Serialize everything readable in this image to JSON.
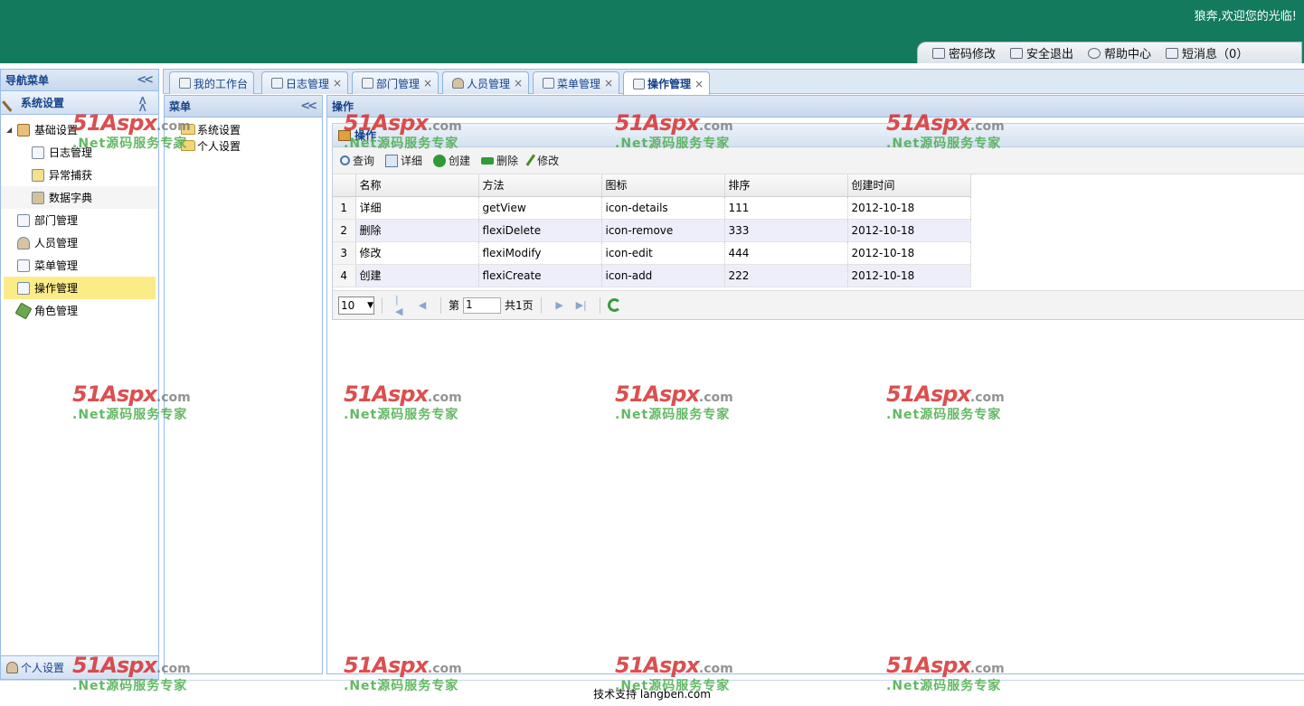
{
  "header": {
    "welcome": "狼奔,欢迎您的光临!",
    "links": [
      "密码修改",
      "安全退出",
      "帮助中心",
      "短消息（0）"
    ]
  },
  "nav": {
    "title": "导航菜单",
    "section": "系统设置",
    "tree": {
      "root": "基础设置",
      "children": [
        "日志管理",
        "异常捕获",
        "数据字典"
      ],
      "items": [
        "部门管理",
        "人员管理",
        "菜单管理",
        "操作管理",
        "角色管理"
      ],
      "selected": "操作管理"
    },
    "footer": "个人设置"
  },
  "tabs": [
    {
      "label": "我的工作台",
      "closable": false
    },
    {
      "label": "日志管理",
      "closable": true
    },
    {
      "label": "部门管理",
      "closable": true
    },
    {
      "label": "人员管理",
      "closable": true
    },
    {
      "label": "菜单管理",
      "closable": true
    },
    {
      "label": "操作管理",
      "closable": true,
      "active": true
    }
  ],
  "menu_panel": {
    "title": "菜单",
    "folders": [
      "系统设置",
      "个人设置"
    ]
  },
  "content": {
    "title": "操作",
    "grid_title": "操作",
    "toolbar": [
      "查询",
      "详细",
      "创建",
      "删除",
      "修改"
    ],
    "columns": [
      "名称",
      "方法",
      "图标",
      "排序",
      "创建时间"
    ],
    "rows": [
      {
        "n": "1",
        "name": "详细",
        "method": "getView",
        "icon": "icon-details",
        "sort": "111",
        "date": "2012-10-18"
      },
      {
        "n": "2",
        "name": "删除",
        "method": "flexiDelete",
        "icon": "icon-remove",
        "sort": "333",
        "date": "2012-10-18"
      },
      {
        "n": "3",
        "name": "修改",
        "method": "flexiModify",
        "icon": "icon-edit",
        "sort": "444",
        "date": "2012-10-18"
      },
      {
        "n": "4",
        "name": "创建",
        "method": "flexiCreate",
        "icon": "icon-add",
        "sort": "222",
        "date": "2012-10-18"
      }
    ],
    "pager": {
      "page_size": "10",
      "page_prefix": "第",
      "page_value": "1",
      "total": "共1页"
    }
  },
  "footer": {
    "text": "技术支持 langben.com"
  },
  "watermark": {
    "brand": "51Aspx",
    "domain": ".com",
    "slogan": ".Net源码服务专家"
  }
}
